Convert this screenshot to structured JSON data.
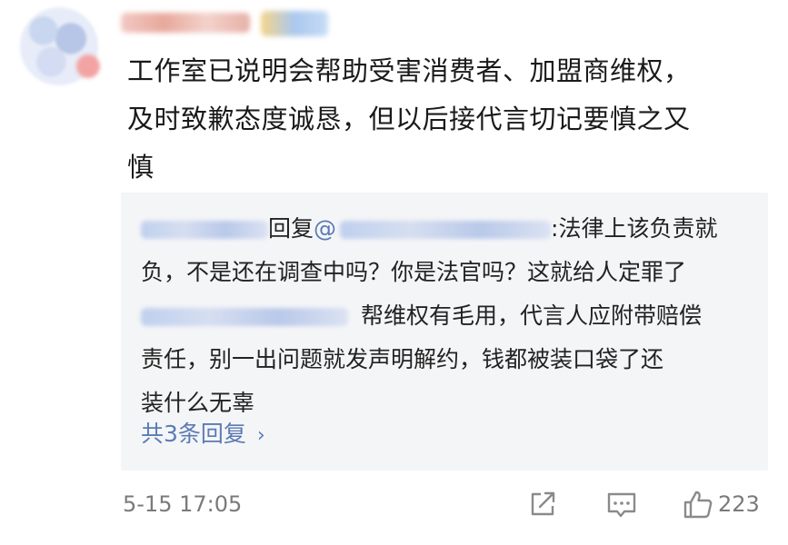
{
  "comment": {
    "text_line1": "工作室已说明会帮助受害消费者、加盟商维权，",
    "text_line2": "及时致歉态度诚恳，但以后接代言切记要慎之又",
    "text_line3": "慎"
  },
  "reply_box": {
    "reply_word": "回复",
    "at_symbol": "@",
    "line1_tail": ":法律上该负责就",
    "line2": "负，不是还在调查中吗？你是法官吗？这就给人定罪了",
    "line3_tail": "帮维权有毛用，代言人应附带赔偿",
    "line4": "责任，别一出问题就发声明解约，钱都被装口袋了还",
    "line5": "装什么无辜",
    "more_replies": "共3条回复",
    "more_chevron": "›"
  },
  "footer": {
    "timestamp": "5-15 17:05",
    "like_count": "223"
  },
  "icons": {
    "share": "share-icon",
    "comment": "comment-icon",
    "like": "thumbs-up-icon"
  },
  "colors": {
    "link": "#5b7bb4",
    "reply_bg": "#f4f5f7",
    "meta": "#7a7a7a"
  }
}
